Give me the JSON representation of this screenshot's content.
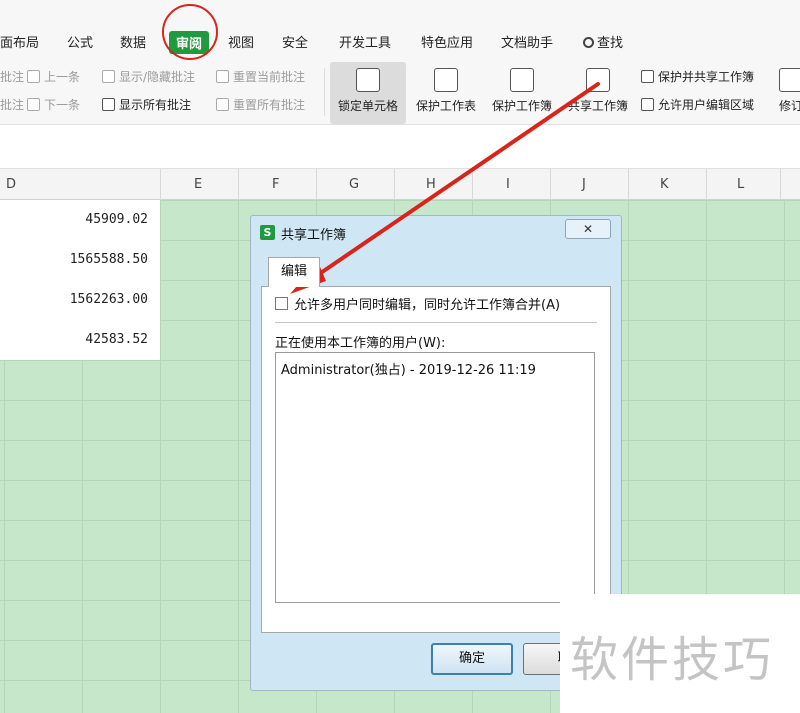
{
  "menu": {
    "items": [
      {
        "key": "page_layout",
        "label": "面布局"
      },
      {
        "key": "formulas",
        "label": "公式"
      },
      {
        "key": "data",
        "label": "数据"
      },
      {
        "key": "review",
        "label": "审阅"
      },
      {
        "key": "view",
        "label": "视图"
      },
      {
        "key": "security",
        "label": "安全"
      },
      {
        "key": "developer",
        "label": "开发工具"
      },
      {
        "key": "features",
        "label": "特色应用"
      },
      {
        "key": "assistant",
        "label": "文档助手"
      }
    ],
    "search_label": "查找",
    "active": "审阅"
  },
  "toolbar": {
    "prev_comment": "上一条",
    "next_comment": "下一条",
    "show_hide_comment": "显示/隐藏批注",
    "show_all_comments": "显示所有批注",
    "reset_current_comment": "重置当前批注",
    "reset_all_comments": "重置所有批注",
    "left_cut_1": "批注",
    "left_cut_2": "批注",
    "lock_cell": "锁定单元格",
    "protect_sheet": "保护工作表",
    "protect_workbook": "保护工作簿",
    "share_workbook": "共享工作簿",
    "protect_and_share": "保护并共享工作簿",
    "allow_edit_ranges": "允许用户编辑区域",
    "track_changes_cut": "修订"
  },
  "sheet": {
    "columns": [
      "D",
      "E",
      "F",
      "G",
      "H",
      "I",
      "J",
      "K",
      "L"
    ],
    "d_values": [
      "45909.02",
      "1565588.50",
      "1562263.00",
      "42583.52"
    ]
  },
  "dialog": {
    "logo": "S",
    "title": "共享工作簿",
    "close": "✕",
    "tab": "编辑",
    "checkbox_label": "允许多用户同时编辑，同时允许工作簿合并(A)",
    "checkbox_checked": false,
    "users_label": "正在使用本工作簿的用户(W):",
    "users": [
      "Administrator(独占) - 2019-12-26 11:19"
    ],
    "ok": "确定",
    "cancel_cut": "取"
  },
  "watermark": "软件技巧",
  "colors": {
    "accent_green": "#1f9a40",
    "annotation_red": "#d9241c",
    "sheet_green": "#c6e7c9"
  }
}
